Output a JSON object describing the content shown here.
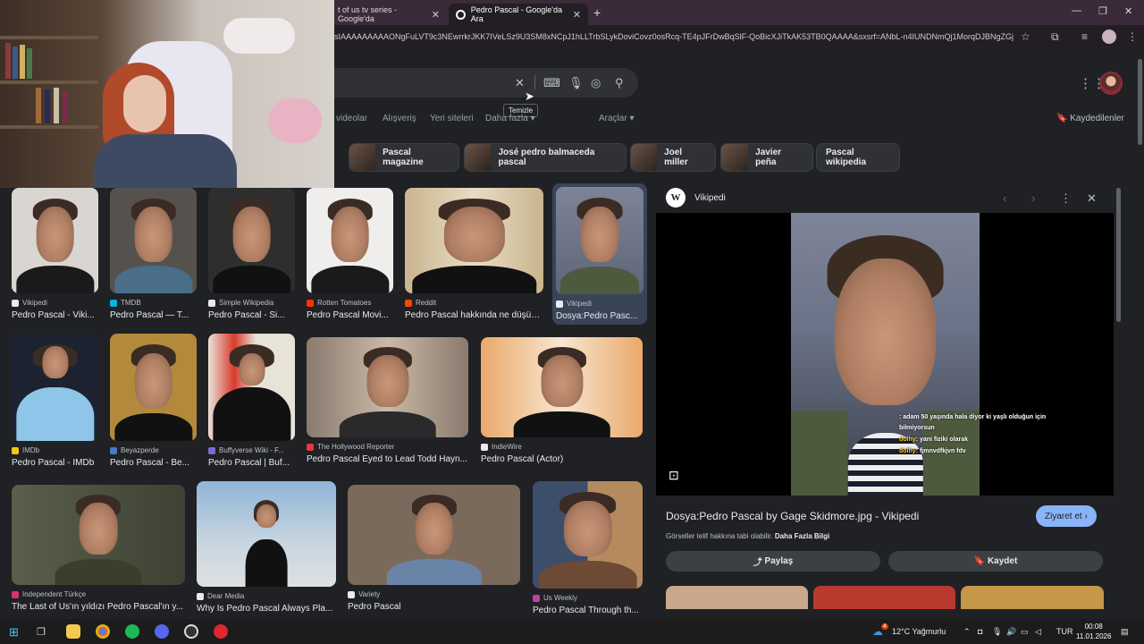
{
  "browser": {
    "tabs": [
      {
        "label": "t of us tv series - Google'da"
      },
      {
        "label": "Pedro Pascal - Google'da Ara"
      }
    ],
    "url": "sIAAAAAAAAAONgFuLVT9c3NEwrrkrJKK7IVeLSz9U3SM8xNCpJ1hLLTrbSLykDoviCovz0osRcq-TE4pJFrDwBqSlF-QoBicXJiTkAK53TB0QAAAA&sxsrf=ANbL-n4IUNDNmQj1MorqDJBNgZGj..."
  },
  "search": {
    "tooltip": "Temizle",
    "nav": [
      "videolar",
      "Alışveriş",
      "Yeri siteleri",
      "Daha fazla",
      "Araçlar"
    ],
    "saved_label": "Kaydedilenler"
  },
  "chips": [
    "Pascal magazine",
    "José pedro balmaceda pascal",
    "Joel miller",
    "Javier peña",
    "Pascal wikipedia"
  ],
  "results": [
    {
      "source": "Vikipedi",
      "title": "Pedro Pascal - Viki...",
      "color": "#e8eaed"
    },
    {
      "source": "TMDB",
      "title": "Pedro Pascal — T...",
      "color": "#01b4e4"
    },
    {
      "source": "Simple Wikipedia",
      "title": "Pedro Pascal - Si...",
      "color": "#e8eaed"
    },
    {
      "source": "Rotten Tomatoes",
      "title": "Pedro Pascal Movi...",
      "color": "#fa320a"
    },
    {
      "source": "Reddit",
      "title": "Pedro Pascal hakkında ne düşün...",
      "color": "#ff4500"
    },
    {
      "source": "Vikipedi",
      "title": "Dosya:Pedro Pasc...",
      "color": "#e8eaed"
    },
    {
      "source": "IMDb",
      "title": "Pedro Pascal - IMDb",
      "color": "#f5c518"
    },
    {
      "source": "Beyazperde",
      "title": "Pedro Pascal - Be...",
      "color": "#4a78c8"
    },
    {
      "source": "Buffyverse Wiki - F...",
      "title": "Pedro Pascal | Buf...",
      "color": "#7b6bd6"
    },
    {
      "source": "The Hollywood Reporter",
      "title": "Pedro Pascal Eyed to Lead Todd Hayn...",
      "color": "#e23a3a"
    },
    {
      "source": "IndieWire",
      "title": "Pedro Pascal (Actor)",
      "color": "#e8eaed"
    },
    {
      "source": "Independent Türkçe",
      "title": "The Last of Us'ın yıldızı Pedro Pascal'ın y...",
      "color": "#d6336c"
    },
    {
      "source": "Dear Media",
      "title": "Why Is Pedro Pascal Always Pla...",
      "color": "#e8eaed"
    },
    {
      "source": "Variety",
      "title": "Pedro Pascal",
      "color": "#e8eaed"
    },
    {
      "source": "Us Weekly",
      "title": "Pedro Pascal Through th...",
      "color": "#c040a0"
    }
  ],
  "panel": {
    "source": "Vikipedi",
    "logo_letter": "W",
    "title": "Dosya:Pedro Pascal by Gage Skidmore.jpg - Vikipedi",
    "note": "Görseller telif hakkına tabi olabilir.",
    "note_link": "Daha Fazla Bilgi",
    "visit_label": "Ziyaret et",
    "share_label": "Paylaş",
    "save_label": "Kaydet"
  },
  "chat": [
    {
      "name": "",
      "text": ": adam 50 yaşında hala diyor ki yaşlı olduğun için"
    },
    {
      "name": "",
      "text": "bilmiyorsun"
    },
    {
      "name": "dolhy",
      "text": ": yani fiziki olarak"
    },
    {
      "name": "dolhy",
      "text": ": fjmnvdfkjvn fdv"
    }
  ],
  "taskbar": {
    "weather": "12°C Yağmurlu",
    "weather_badge": "4",
    "lang": "TUR",
    "time": "00:08",
    "date": "11.01.2026"
  }
}
